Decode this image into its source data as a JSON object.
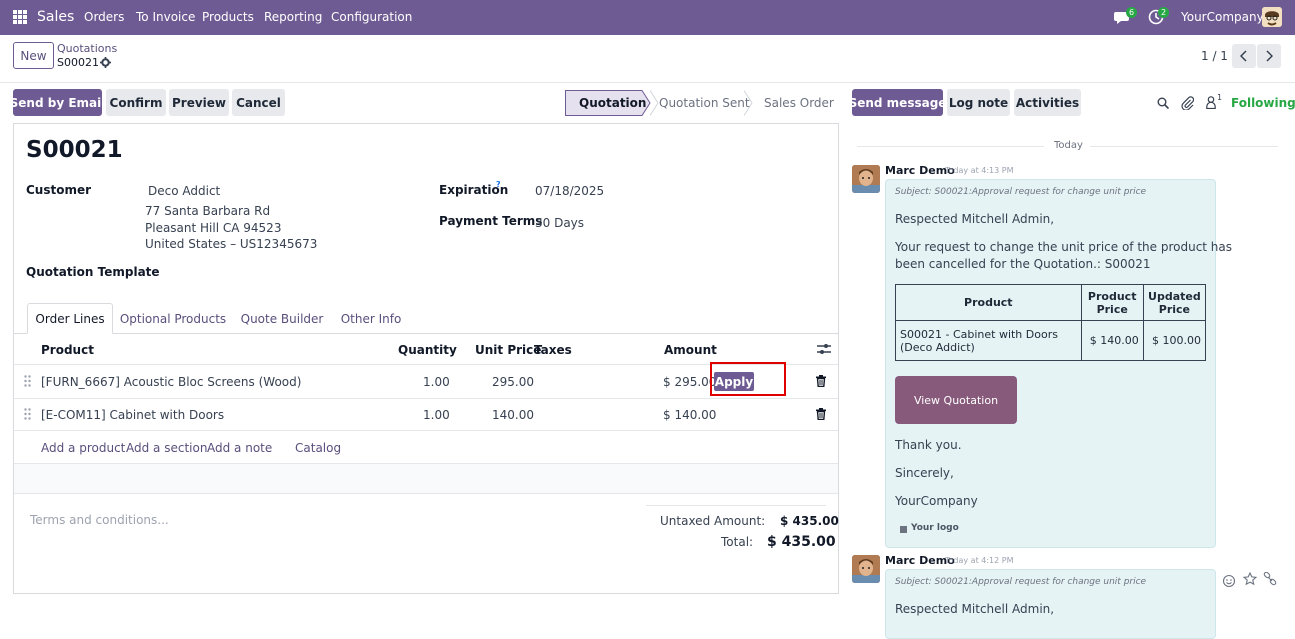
{
  "topbar": {
    "app_name": "Sales",
    "menu": [
      "Orders",
      "To Invoice",
      "Products",
      "Reporting",
      "Configuration"
    ],
    "messages_count": "6",
    "activities_count": "2",
    "company": "YourCompany"
  },
  "control": {
    "new_label": "New",
    "breadcrumb_parent": "Quotations",
    "breadcrumb_current": "S00021",
    "pager": "1 / 1"
  },
  "actions": {
    "send_email": "Send by Email",
    "confirm": "Confirm",
    "preview": "Preview",
    "cancel": "Cancel"
  },
  "statusbar": [
    "Quotation",
    "Quotation Sent",
    "Sales Order"
  ],
  "chatter_actions": {
    "send_message": "Send message",
    "log_note": "Log note",
    "activities": "Activities",
    "followers": "1",
    "following": "Following"
  },
  "form": {
    "title": "S00021",
    "customer_label": "Customer",
    "customer_name": "Deco Addict",
    "address1": "77 Santa Barbara Rd",
    "address2": "Pleasant Hill CA 94523",
    "address3": "United States – US12345673",
    "template_label": "Quotation Template",
    "expiration_label": "Expiration",
    "expiration_help": "?",
    "expiration_value": "07/18/2025",
    "payment_terms_label": "Payment Terms",
    "payment_terms_value": "30 Days"
  },
  "tabs": [
    "Order Lines",
    "Optional Products",
    "Quote Builder",
    "Other Info"
  ],
  "table": {
    "headers": {
      "product": "Product",
      "quantity": "Quantity",
      "unit_price": "Unit Price",
      "taxes": "Taxes",
      "amount": "Amount"
    },
    "rows": [
      {
        "product": "[FURN_6667] Acoustic Bloc Screens (Wood)",
        "quantity": "1.00",
        "unit_price": "295.00",
        "amount": "$ 295.00",
        "action": "Apply"
      },
      {
        "product": "[E-COM11] Cabinet with Doors",
        "quantity": "1.00",
        "unit_price": "140.00",
        "amount": "$ 140.00"
      }
    ],
    "add_links": [
      "Add a product",
      "Add a section",
      "Add a note",
      "Catalog"
    ]
  },
  "totals": {
    "terms_placeholder": "Terms and conditions...",
    "untaxed_label": "Untaxed Amount:",
    "untaxed_value": "$ 435.00",
    "total_label": "Total:",
    "total_value": "$ 435.00"
  },
  "chatter": {
    "day_separator": "Today",
    "messages": [
      {
        "author": "Marc Demo",
        "time": "Today at 4:13 PM",
        "subject": "Subject: S00021:Approval request for change unit price",
        "greeting": "Respected Mitchell Admin,",
        "body_line1": "Your request to change the unit price of the product has",
        "body_line2": "been cancelled for the Quotation.: S00021",
        "table_headers": [
          "Product",
          "Product Price",
          "Updated Price"
        ],
        "table_row": [
          "S00021 - Cabinet with Doors (Deco Addict)",
          "$ 140.00",
          "$ 100.00"
        ],
        "button": "View Quotation",
        "thanks": "Thank you.",
        "sincerely": "Sincerely,",
        "company": "YourCompany",
        "logo": "Your logo"
      },
      {
        "author": "Marc Demo",
        "time": "Today at 4:12 PM",
        "subject": "Subject: S00021:Approval request for change unit price",
        "greeting": "Respected Mitchell Admin,"
      }
    ]
  },
  "colors": {
    "brand": "#6f5b94",
    "link": "#5a4f7c",
    "following": "#28a745",
    "message_bg": "#e6f3f5",
    "highlight": "#e00000"
  }
}
